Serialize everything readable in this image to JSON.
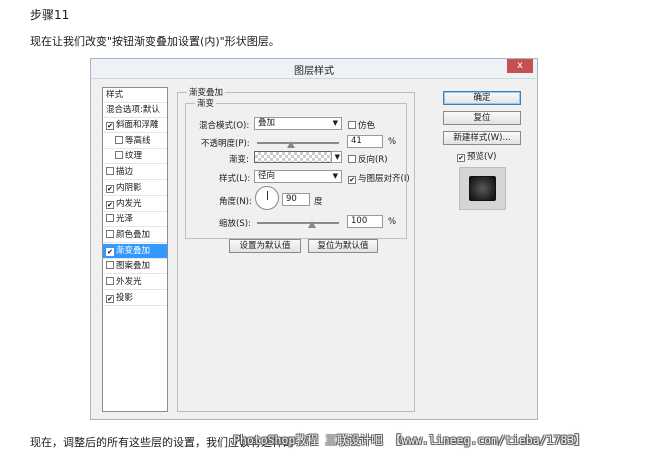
{
  "article": {
    "step": "步骤11",
    "intro": "现在让我们改变\"按钮渐变叠加设置(内)\"形状图层。",
    "outro": "现在，调整后的所有这些层的设置，我们应该有这样的",
    "watermark": "PhotoShop教程 三联设计吧 【www.lineeg.com/tieba/1783】"
  },
  "dialog": {
    "title": "图层样式",
    "close": "x",
    "styles_header": "样式",
    "blend_options": "混合选项:默认",
    "style_list": [
      {
        "label": "斜面和浮雕",
        "checked": true,
        "indent": false,
        "selected": false
      },
      {
        "label": "等高线",
        "checked": false,
        "indent": true,
        "selected": false
      },
      {
        "label": "纹理",
        "checked": false,
        "indent": true,
        "selected": false
      },
      {
        "label": "描边",
        "checked": false,
        "indent": false,
        "selected": false
      },
      {
        "label": "内阴影",
        "checked": true,
        "indent": false,
        "selected": false
      },
      {
        "label": "内发光",
        "checked": true,
        "indent": false,
        "selected": false
      },
      {
        "label": "光泽",
        "checked": false,
        "indent": false,
        "selected": false
      },
      {
        "label": "颜色叠加",
        "checked": false,
        "indent": false,
        "selected": false
      },
      {
        "label": "渐变叠加",
        "checked": true,
        "indent": false,
        "selected": true
      },
      {
        "label": "图案叠加",
        "checked": false,
        "indent": false,
        "selected": false
      },
      {
        "label": "外发光",
        "checked": false,
        "indent": false,
        "selected": false
      },
      {
        "label": "投影",
        "checked": true,
        "indent": false,
        "selected": false
      }
    ],
    "panel": {
      "title": "渐变叠加",
      "sub_title": "渐变",
      "blend_mode_label": "混合模式(O):",
      "blend_mode_value": "叠加",
      "dither_label": "仿色",
      "dither_checked": false,
      "opacity_label": "不透明度(P):",
      "opacity_value": "41",
      "opacity_fraction": 0.41,
      "percent": "%",
      "gradient_label": "渐变:",
      "reverse_label": "反向(R)",
      "reverse_checked": false,
      "style_label": "样式(L):",
      "style_value": "径向",
      "align_label": "与图层对齐(I)",
      "align_checked": true,
      "angle_label": "角度(N):",
      "angle_value": "90",
      "degree": "度",
      "scale_label": "缩放(S):",
      "scale_value": "100",
      "scale_fraction": 0.67,
      "set_default": "设置为默认值",
      "reset_default": "复位为默认值"
    },
    "buttons": {
      "ok": "确定",
      "reset": "复位",
      "new_style": "新建样式(W)...",
      "preview_label": "预览(V)",
      "preview_checked": true
    }
  }
}
